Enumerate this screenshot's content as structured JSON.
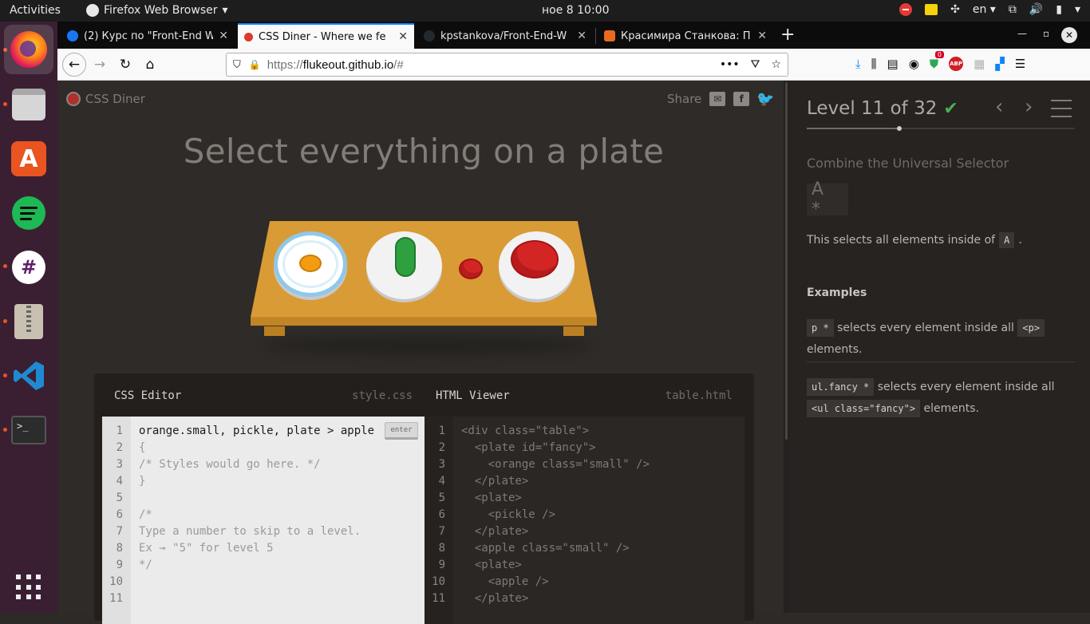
{
  "system": {
    "activities": "Activities",
    "app_name": "Firefox Web Browser",
    "clock": "ное 8  10:00",
    "lang": "en"
  },
  "tabs": [
    {
      "label": "(2) Курс по \"Front-End W",
      "favicon_color": "#1877f2"
    },
    {
      "label": "CSS Diner - Where we fe",
      "favicon_color": "#d93a2b",
      "active": true
    },
    {
      "label": "kpstankova/Front-End-W",
      "favicon_color": "#24292e"
    },
    {
      "label": "Красимира Станкова: П",
      "favicon_color": "#e86a1c"
    }
  ],
  "nav": {
    "url_prefix": "https://",
    "url_host": "flukeout.github.io",
    "url_path": "/#",
    "badge_count": "0"
  },
  "page": {
    "brand": "CSS Diner",
    "share": "Share",
    "heading": "Select everything on a plate"
  },
  "editor": {
    "css_title": "CSS Editor",
    "css_file": "style.css",
    "html_title": "HTML Viewer",
    "html_file": "table.html",
    "enter_label": "enter",
    "css_lines": [
      "orange.small, pickle, plate > apple",
      "{",
      "/* Styles would go here. */",
      "}",
      "",
      "/*",
      "Type a number to skip to a level.",
      "Ex → \"5\" for level 5",
      "*/",
      "",
      ""
    ],
    "html_lines": [
      "<div class=\"table\">",
      "  <plate id=\"fancy\">",
      "    <orange class=\"small\" />",
      "  </plate>",
      "  <plate>",
      "    <pickle />",
      "  </plate>",
      "  <apple class=\"small\" />",
      "  <plate>",
      "    <apple />",
      "  </plate>"
    ]
  },
  "sidebar": {
    "level_title": "Level 11 of 32",
    "level_current": 11,
    "level_total": 32,
    "selector_name": "Combine the Universal Selector",
    "syntax": "A *",
    "hint_prefix": "This selects all elements inside of",
    "hint_chip": "A",
    "hint_suffix": ".",
    "examples_heading": "Examples",
    "examples": [
      {
        "chip": "p *",
        "text": "selects every element inside all",
        "chip2": "<p>",
        "text2": "elements."
      },
      {
        "chip": "ul.fancy *",
        "text": "selects every element inside all",
        "chip2": "<ul class=\"fancy\">",
        "text2": "elements."
      }
    ]
  },
  "colors": {
    "accent_blue": "#0a84ff",
    "check_green": "#4cae4c",
    "table_wood": "#d99b36"
  }
}
